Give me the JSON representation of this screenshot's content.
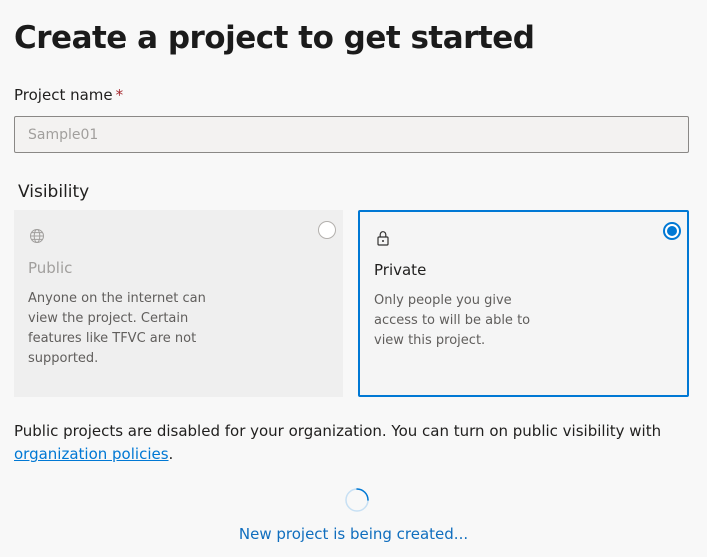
{
  "page": {
    "title": "Create a project to get started"
  },
  "project_name": {
    "label": "Project name",
    "required_marker": "*",
    "value": "Sample01"
  },
  "visibility": {
    "label": "Visibility",
    "options": [
      {
        "id": "public",
        "name": "Public",
        "description": "Anyone on the internet can view the project. Certain features like TFVC are not supported.",
        "icon": "globe-icon",
        "selected": false,
        "disabled": true
      },
      {
        "id": "private",
        "name": "Private",
        "description": "Only people you give access to will be able to view this project.",
        "icon": "lock-icon",
        "selected": true,
        "disabled": false
      }
    ]
  },
  "notice": {
    "text": "Public projects are disabled for your organization. You can turn on public visibility with ",
    "link_text": "organization policies",
    "suffix": "."
  },
  "status": {
    "text": "New project is being created..."
  },
  "colors": {
    "accent": "#0078d4",
    "required": "#a4262c",
    "disabled_text": "#a19f9d"
  }
}
